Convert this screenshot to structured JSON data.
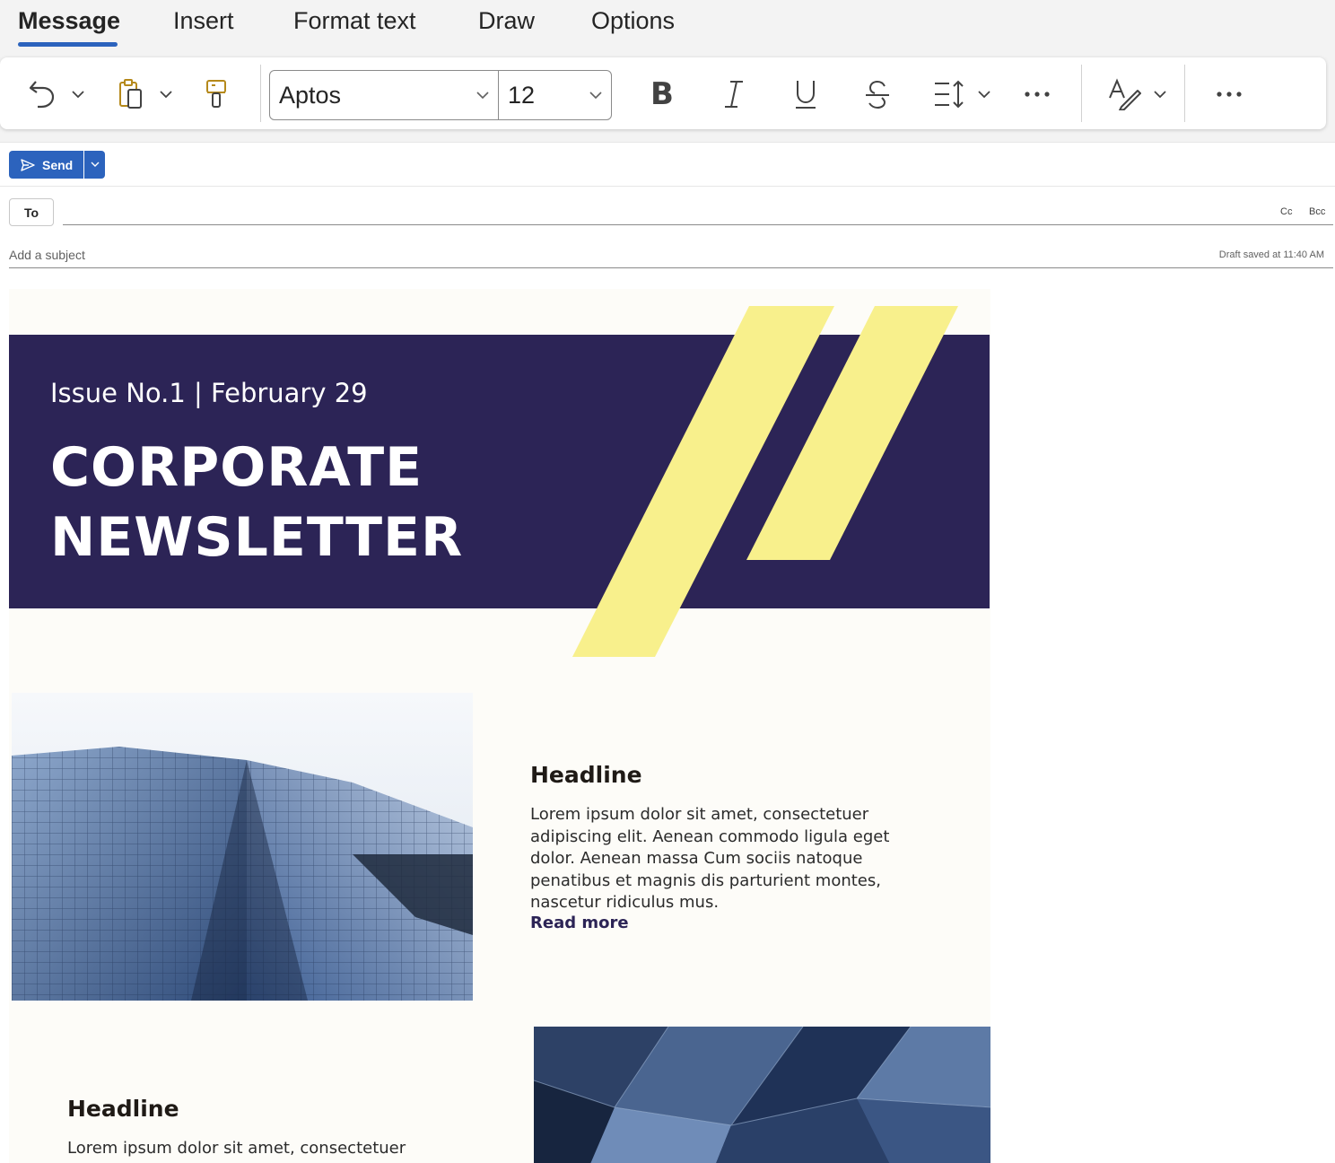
{
  "tabs": [
    {
      "label": "Message",
      "active": true
    },
    {
      "label": "Insert"
    },
    {
      "label": "Format text"
    },
    {
      "label": "Draw"
    },
    {
      "label": "Options"
    }
  ],
  "toolbar": {
    "font_name": "Aptos",
    "font_size": "12",
    "icons": [
      "undo-icon",
      "paste-icon",
      "format-painter-icon",
      "bold-icon",
      "italic-icon",
      "underline-icon",
      "strikethrough-icon",
      "line-spacing-icon",
      "more-icon",
      "editor-icon",
      "more-icon"
    ],
    "bold_glyph": "B",
    "italic_glyph": "I",
    "underline_glyph": "U",
    "strike_glyph": "S"
  },
  "compose": {
    "send_label": "Send",
    "to_label": "To",
    "cc_label": "Cc",
    "bcc_label": "Bcc",
    "subject_placeholder": "Add a subject",
    "draft_status": "Draft saved at 11:40 AM"
  },
  "newsletter": {
    "issue": "Issue No.1 | February 29",
    "title_line1": "CORPORATE",
    "title_line2": "NEWSLETTER",
    "articles": [
      {
        "headline": "Headline",
        "body": "Lorem ipsum dolor sit amet, consectetuer adipiscing elit. Aenean commodo ligula eget dolor. Aenean massa Cum sociis natoque penatibus et magnis dis parturient montes, nascetur ridiculus mus.",
        "link": "Read more"
      },
      {
        "headline": "Headline",
        "body": "Lorem ipsum dolor sit amet, consectetuer adipiscing"
      }
    ],
    "colors": {
      "banner": "#2c2456",
      "accent": "#f8f08c",
      "background": "#fdfcf8",
      "brand_blue": "#2c63bd"
    }
  }
}
